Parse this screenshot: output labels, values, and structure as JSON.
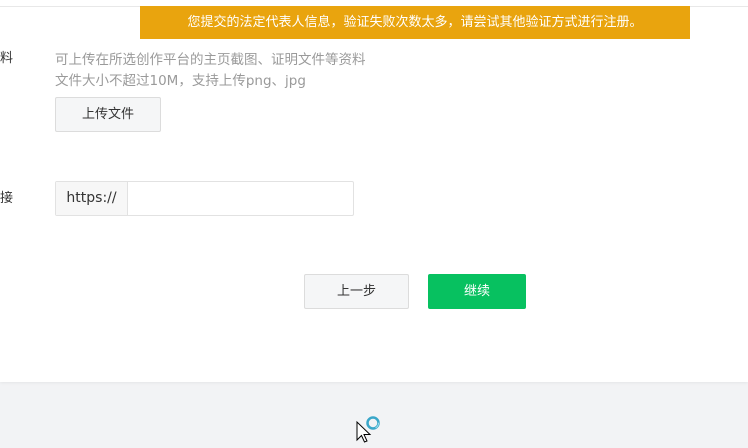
{
  "notice": {
    "text": "您提交的法定代表人信息，验证失败次数太多，请尝试其他验证方式进行注册。",
    "color": "#e9a40e"
  },
  "materials": {
    "label": "资料",
    "hint_line1": "可上传在所选创作平台的主页截图、证明文件等资料",
    "hint_line2": "文件大小不超过10M，支持上传png、jpg",
    "upload_button": "上传文件"
  },
  "link": {
    "label": "链接",
    "prefix": "https://",
    "value": "",
    "placeholder": ""
  },
  "actions": {
    "prev_label": "上一步",
    "next_label": "继续",
    "next_color": "#07c160"
  },
  "cursor": {
    "icon": "busy-pointer-icon"
  }
}
